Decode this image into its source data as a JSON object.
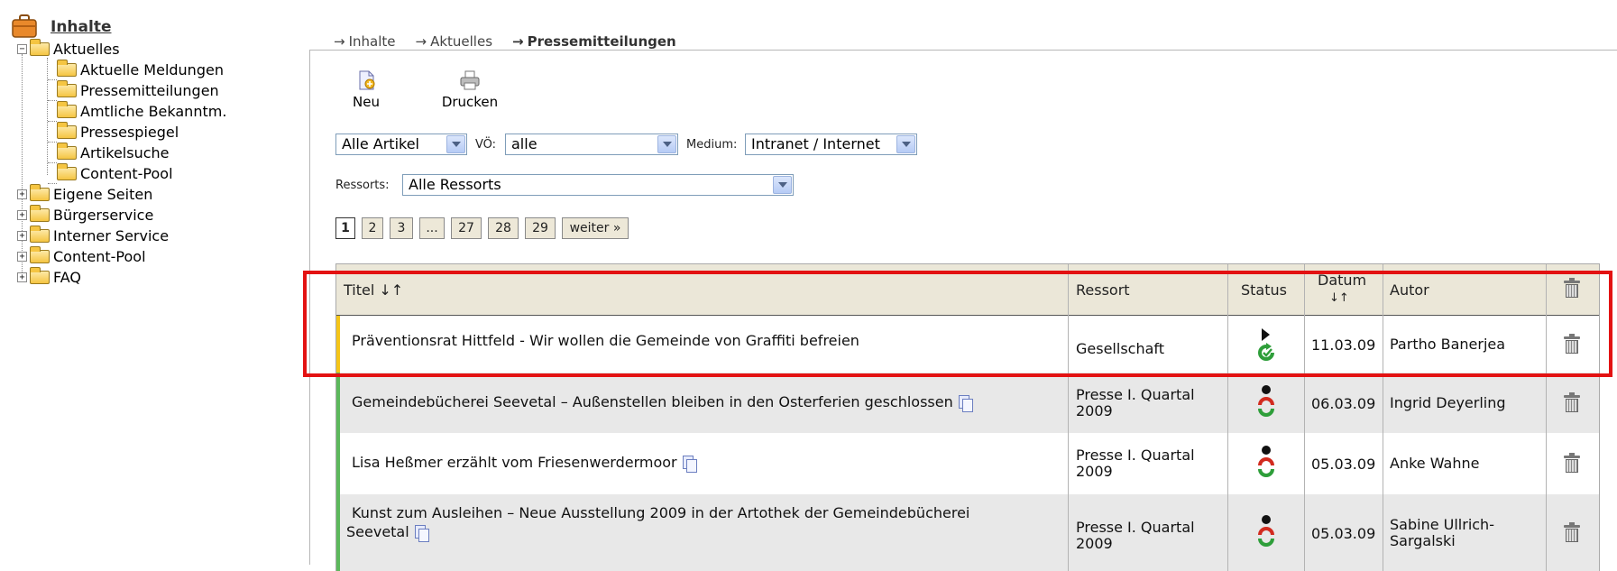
{
  "tree": {
    "root": "Inhalte",
    "aktuelles": "Aktuelles",
    "children": [
      "Aktuelle Meldungen",
      "Pressemitteilungen",
      "Amtliche Bekanntm.",
      "Pressespiegel",
      "Artikelsuche",
      "Content-Pool"
    ],
    "others": [
      "Eigene Seiten",
      "Bürgerservice",
      "Interner Service",
      "Content-Pool",
      "FAQ"
    ],
    "collapse_glyph": "−",
    "expand_glyph": "+"
  },
  "breadcrumb": {
    "arrow": "→",
    "items": [
      "Inhalte",
      "Aktuelles",
      "Pressemitteilungen"
    ]
  },
  "toolbar": {
    "new_label": "Neu",
    "print_label": "Drucken"
  },
  "filters": {
    "article_select": "Alle Artikel",
    "vo_label": "VÖ:",
    "vo_select": "alle",
    "medium_label": "Medium:",
    "medium_select": "Intranet / Internet",
    "ressorts_label": "Ressorts:",
    "ressorts_select": "Alle Ressorts"
  },
  "pagination": {
    "pages": [
      "1",
      "2",
      "3",
      "...",
      "27",
      "28",
      "29"
    ],
    "next": "weiter »",
    "current": "1"
  },
  "table": {
    "headers": {
      "title": "Titel ↓↑",
      "ressort": "Ressort",
      "status": "Status",
      "date": "Datum",
      "date_sort": "↓↑",
      "author": "Autor"
    },
    "rows": [
      {
        "title_line1": "Präventionsrat Hittfeld - Wir wollen die Gemeinde von Graffiti befreien",
        "title_line2": "",
        "ressort_line1": "Gesellschaft",
        "ressort_line2": "",
        "date": "11.03.09",
        "author_line1": "Partho Banerjea",
        "author_line2": "",
        "status": "published",
        "copy_icon": false,
        "bar_color": "#f5c518",
        "bg": "#ffffff"
      },
      {
        "title_line1": "Gemeindebücherei Seevetal – Außenstellen bleiben in den Osterferien geschlossen",
        "title_line2": "",
        "ressort_line1": "Presse I. Quartal",
        "ressort_line2": "2009",
        "date": "06.03.09",
        "author_line1": "Ingrid Deyerling",
        "author_line2": "",
        "status": "stopped",
        "copy_icon": true,
        "bar_color": "#5cb85c",
        "bg": "#e8e8e8"
      },
      {
        "title_line1": "Lisa Heßmer erzählt vom Friesenwerdermoor",
        "title_line2": "",
        "ressort_line1": "Presse I. Quartal",
        "ressort_line2": "2009",
        "date": "05.03.09",
        "author_line1": "Anke Wahne",
        "author_line2": "",
        "status": "stopped",
        "copy_icon": true,
        "bar_color": "#5cb85c",
        "bg": "#ffffff"
      },
      {
        "title_line1": "Kunst zum Ausleihen – Neue Ausstellung 2009 in der Artothek der Gemeindebücherei",
        "title_line2": "Seevetal",
        "ressort_line1": "Presse I. Quartal",
        "ressort_line2": "2009",
        "date": "05.03.09",
        "author_line1": "Sabine Ullrich-",
        "author_line2": "Sargalski",
        "status": "stopped",
        "copy_icon": true,
        "bar_color": "#5cb85c",
        "bg": "#e8e8e8"
      }
    ]
  },
  "colors": {
    "highlight": "#e31212",
    "header_bg": "#ebe7d8",
    "published_green": "#2e9e3a",
    "stopped_red": "#d22b1f"
  },
  "icons": {
    "new": "new-document-icon",
    "print": "printer-icon",
    "delete": "trash-icon",
    "root": "briefcase-icon"
  }
}
